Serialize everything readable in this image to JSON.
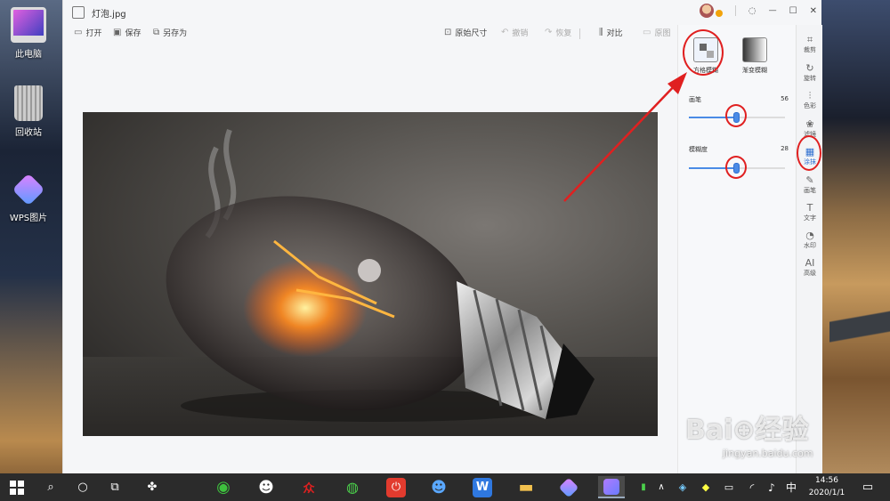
{
  "desktop": {
    "icons": [
      {
        "label": "此电脑"
      },
      {
        "label": "回收站"
      },
      {
        "label": "WPS图片"
      }
    ]
  },
  "window": {
    "title": "灯泡.jpg",
    "controls": {
      "minimize": "—",
      "maximize": "☐",
      "close": "✕"
    }
  },
  "toolbar": {
    "open": "打开",
    "save": "保存",
    "save_as": "另存为",
    "original_size": "原始尺寸",
    "undo": "撤销",
    "redo": "恢复",
    "compare": "对比",
    "reset": "原图"
  },
  "panel": {
    "modes": [
      {
        "label": "方格模糊",
        "active": true
      },
      {
        "label": "渐变模糊",
        "active": false
      }
    ],
    "brush": {
      "label": "画笔",
      "value": "56",
      "fraction": 0.5
    },
    "blur": {
      "label": "模糊度",
      "value": "28",
      "fraction": 0.5
    }
  },
  "rail": [
    {
      "icon": "crop-icon",
      "glyph": "⌗",
      "label": "裁剪",
      "active": false
    },
    {
      "icon": "rotate-icon",
      "glyph": "↻",
      "label": "旋转",
      "active": false
    },
    {
      "icon": "color-icon",
      "glyph": "⫶",
      "label": "色彩",
      "active": false
    },
    {
      "icon": "filter-icon",
      "glyph": "❀",
      "label": "滤镜",
      "active": false
    },
    {
      "icon": "mosaic-icon",
      "glyph": "▦",
      "label": "涂抹",
      "active": true
    },
    {
      "icon": "brush-icon",
      "glyph": "✎",
      "label": "画笔",
      "active": false
    },
    {
      "icon": "text-icon",
      "glyph": "T",
      "label": "文字",
      "active": false
    },
    {
      "icon": "watermark-icon",
      "glyph": "◔",
      "label": "水印",
      "active": false
    },
    {
      "icon": "ai-icon",
      "glyph": "AI",
      "label": "高级",
      "active": false
    }
  ],
  "taskbar": {
    "time": "14:56",
    "date": "2020/1/1",
    "ime": "中",
    "notification_glyph": "▭"
  },
  "watermark": {
    "main": "Bai⊕经验",
    "sub": "jingyan.baidu.com"
  },
  "colors": {
    "accent": "#4a8be6",
    "annotation_red": "#e02020",
    "taskbar": "#2b2b2b"
  }
}
